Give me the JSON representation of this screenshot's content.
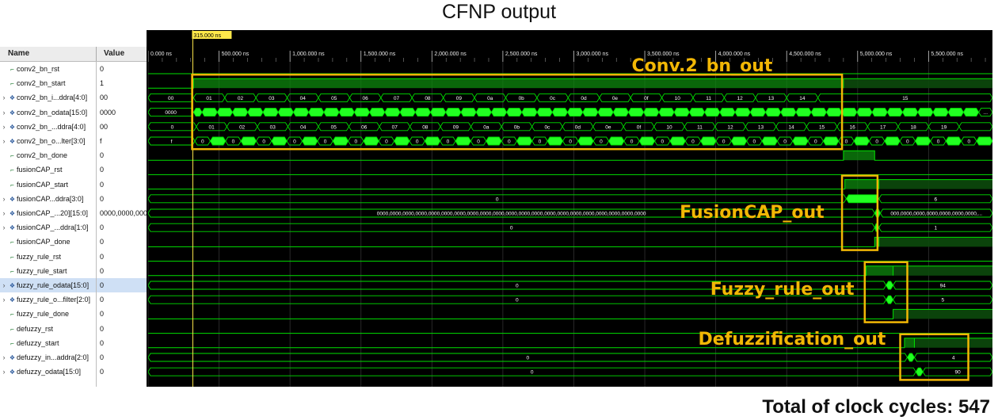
{
  "title": "CFNP output",
  "footer": "Total of clock cycles: 547",
  "colors": {
    "background": "#000000",
    "wave": "#00e000",
    "wave_bright": "#22ff22",
    "cursor": "#ffe84a",
    "annotation": "#f2b705",
    "grid": "#323232"
  },
  "viewer": {
    "header_name": "Name",
    "header_value": "Value",
    "cursor_label": "315.000 ns",
    "cursor_time_ns": 315,
    "time_range_ns": [
      0,
      5950
    ],
    "ruler_ticks": [
      {
        "t": 0,
        "label": "0.000 ns"
      },
      {
        "t": 500,
        "label": "500.000 ns"
      },
      {
        "t": 1000,
        "label": "1,000.000 ns"
      },
      {
        "t": 1500,
        "label": "1,500.000 ns"
      },
      {
        "t": 2000,
        "label": "2,000.000 ns"
      },
      {
        "t": 2500,
        "label": "2,500.000 ns"
      },
      {
        "t": 3000,
        "label": "3,000.000 ns"
      },
      {
        "t": 3500,
        "label": "3,500.000 ns"
      },
      {
        "t": 4000,
        "label": "4,000.000 ns"
      },
      {
        "t": 4500,
        "label": "4,500.000 ns"
      },
      {
        "t": 5000,
        "label": "5,000.000 ns"
      },
      {
        "t": 5500,
        "label": "5,500.000 ns"
      }
    ],
    "signals": [
      {
        "name": "conv2_bn_rst",
        "value": "0",
        "type": "bit",
        "expandable": false
      },
      {
        "name": "conv2_bn_start",
        "value": "1",
        "type": "bit",
        "expandable": false
      },
      {
        "name": "conv2_bn_i...ddra[4:0]",
        "value": "00",
        "type": "bus",
        "expandable": true
      },
      {
        "name": "conv2_bn_odata[15:0]",
        "value": "0000",
        "type": "bus",
        "expandable": true
      },
      {
        "name": "conv2_bn_...ddra[4:0]",
        "value": "00",
        "type": "bus",
        "expandable": true
      },
      {
        "name": "conv2_bn_o...lter[3:0]",
        "value": "f",
        "type": "bus",
        "expandable": true
      },
      {
        "name": "conv2_bn_done",
        "value": "0",
        "type": "bit",
        "expandable": false
      },
      {
        "name": "fusionCAP_rst",
        "value": "0",
        "type": "bit",
        "expandable": false
      },
      {
        "name": "fusionCAP_start",
        "value": "0",
        "type": "bit",
        "expandable": false
      },
      {
        "name": "fusionCAP...ddra[3:0]",
        "value": "0",
        "type": "bus",
        "expandable": true
      },
      {
        "name": "fusionCAP_...20][15:0]",
        "value": "0000,0000,000",
        "type": "bus",
        "expandable": true
      },
      {
        "name": "fusionCAP_...ddra[1:0]",
        "value": "0",
        "type": "bus",
        "expandable": true
      },
      {
        "name": "fusionCAP_done",
        "value": "0",
        "type": "bit",
        "expandable": false
      },
      {
        "name": "fuzzy_rule_rst",
        "value": "0",
        "type": "bit",
        "expandable": false
      },
      {
        "name": "fuzzy_rule_start",
        "value": "0",
        "type": "bit",
        "expandable": false
      },
      {
        "name": "fuzzy_rule_odata[15:0]",
        "value": "0",
        "type": "bus",
        "expandable": true,
        "selected": true
      },
      {
        "name": "fuzzy_rule_o...filter[2:0]",
        "value": "0",
        "type": "bus",
        "expandable": true
      },
      {
        "name": "fuzzy_rule_done",
        "value": "0",
        "type": "bit",
        "expandable": false
      },
      {
        "name": "defuzzy_rst",
        "value": "0",
        "type": "bit",
        "expandable": false
      },
      {
        "name": "defuzzy_start",
        "value": "0",
        "type": "bit",
        "expandable": false
      },
      {
        "name": "defuzzy_in...addra[2:0]",
        "value": "0",
        "type": "bus",
        "expandable": true
      },
      {
        "name": "defuzzy_odata[15:0]",
        "value": "0",
        "type": "bus",
        "expandable": true
      }
    ],
    "waves": {
      "conv2_bn_start": {
        "high": [
          [
            320,
            4900
          ]
        ],
        "high_dim": [
          [
            4900,
            5950
          ]
        ]
      },
      "conv2_bn_done": {
        "high": [
          [
            4900,
            5120
          ]
        ]
      },
      "fusionCAP_start": {
        "high": [
          [
            4910,
            5150
          ]
        ],
        "high_dim": [
          [
            5150,
            5950
          ]
        ]
      },
      "fusionCAP_done": {
        "high": [
          [
            5120,
            5150
          ]
        ],
        "high_dim": [
          [
            5150,
            5950
          ]
        ]
      },
      "fuzzy_rule_start": {
        "high": [
          [
            5060,
            5250
          ]
        ],
        "high_dim": [
          [
            5250,
            5950
          ]
        ]
      },
      "fuzzy_rule_done": {
        "high_dim": [
          [
            5250,
            5950
          ]
        ]
      },
      "defuzzy_start": {
        "high": [
          [
            5330,
            5400
          ]
        ],
        "high_dim": [
          [
            5400,
            5950
          ]
        ]
      },
      "conv2_bn_iaddra": {
        "labels": [
          "00",
          "01",
          "02",
          "03",
          "04",
          "05",
          "06",
          "07",
          "08",
          "09",
          "0a",
          "0b",
          "0c",
          "0d",
          "0e",
          "0f",
          "10",
          "11",
          "12",
          "13",
          "14",
          "15"
        ]
      },
      "conv2_bn_oaddra": {
        "labels": [
          "0",
          "01",
          "02",
          "03",
          "04",
          "05",
          "06",
          "07",
          "08",
          "09",
          "0a",
          "0b",
          "0c",
          "0d",
          "0e",
          "0f",
          "10",
          "11",
          "12",
          "13",
          "14",
          "15",
          "16",
          "17",
          "18",
          "19"
        ]
      },
      "conv2_bn_odata_first": "0000",
      "conv2_bn_odata_mid": "...",
      "conv2_bn_ofilter_first": "f",
      "conv2_bn_ofilter_mid": "0",
      "fusionCAP_addra": {
        "before": "0",
        "after": "6"
      },
      "fusionCAP_data": {
        "before": "0000,0000,0000,0000,0000,0000,0000,0000,0000,0000,0000,0000,0000,0000,0000,0000,0000,0000,0000,0000,0000",
        "after": "000,0000,0000,0000,0000,0000,0000,..."
      },
      "fusionCAP_oaddra": {
        "before": "0",
        "after": "1"
      },
      "fuzzy_rule_odata": {
        "before": "0",
        "after": "94"
      },
      "fuzzy_rule_ofilter": {
        "before": "0",
        "after": "5"
      },
      "defuzzy_addra": {
        "before": "0",
        "after": "4"
      },
      "defuzzy_odata": {
        "before": "0",
        "after": "90"
      }
    }
  },
  "annotations": [
    {
      "label": "Conv.2_bn_out",
      "box": {
        "t0": 310,
        "t1": 4890,
        "row0": 1,
        "row1": 5
      }
    },
    {
      "label": "FusionCAP_out",
      "box": {
        "t0": 4890,
        "t1": 5140,
        "row0": 8,
        "row1": 12
      }
    },
    {
      "label": "Fuzzy_rule_out",
      "box": {
        "t0": 5050,
        "t1": 5350,
        "row0": 14,
        "row1": 17
      }
    },
    {
      "label": "Defuzzification_out",
      "box": {
        "t0": 5300,
        "t1": 5780,
        "row0": 19,
        "row1": 21
      }
    }
  ]
}
